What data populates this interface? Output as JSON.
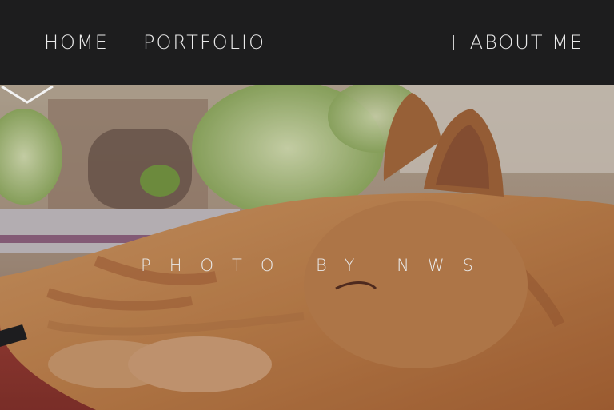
{
  "nav": {
    "home_label": "HOME",
    "portfolio_label": "PORTFOLIO",
    "about_label": "ABOUT ME"
  },
  "hero": {
    "caption": "PHOTO BY NWS",
    "scroll_icon": "chevron-down-icon"
  },
  "colors": {
    "nav_bg": "#1d1d1e",
    "nav_text": "#eaeaea"
  }
}
